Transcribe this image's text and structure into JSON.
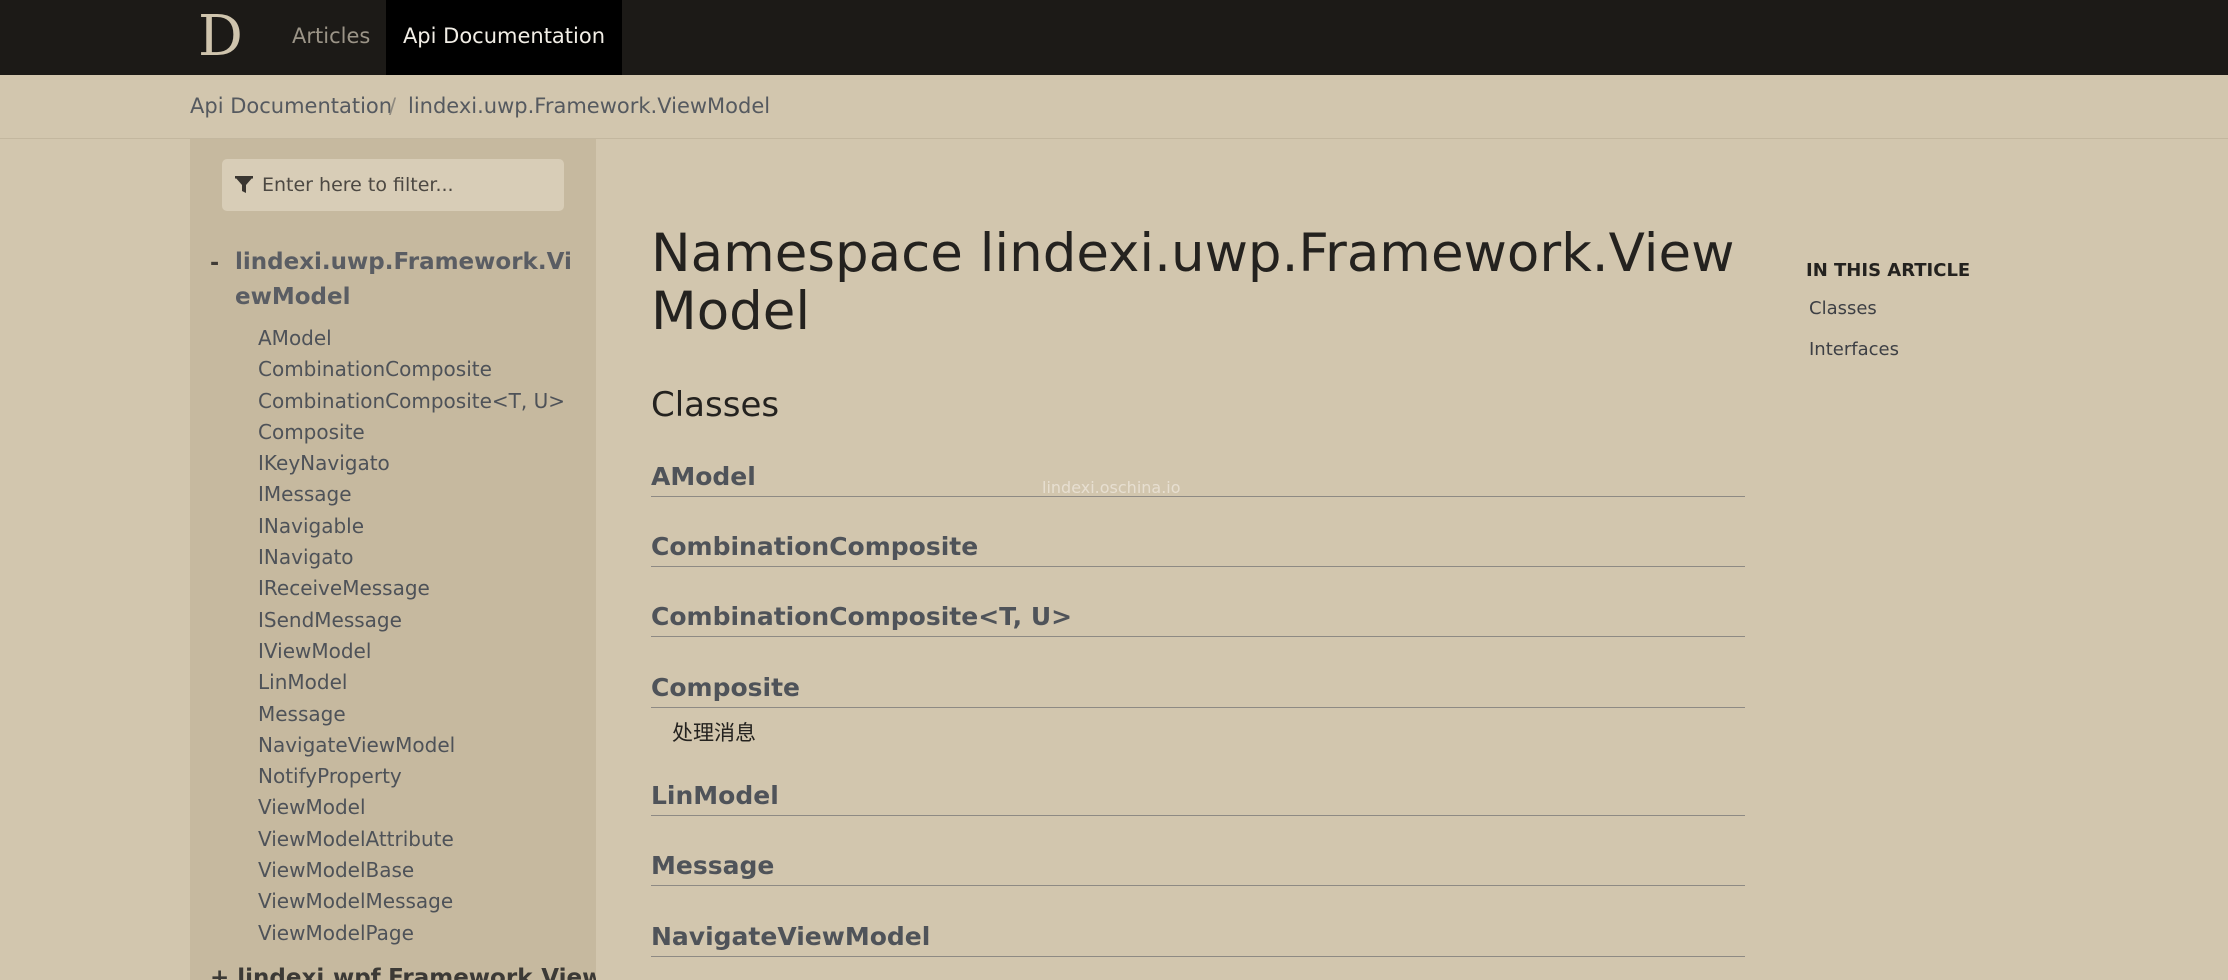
{
  "nav": {
    "logo": "D",
    "articles": "Articles",
    "api_documentation": "Api Documentation"
  },
  "breadcrumb": {
    "root": "Api Documentation",
    "separator": "/",
    "current": "lindexi.uwp.Framework.ViewModel"
  },
  "sidebar": {
    "filter_placeholder": "Enter here to filter...",
    "toggle": "-",
    "namespace": "lindexi.uwp.Framework.ViewModel",
    "items": [
      "AModel",
      "CombinationComposite",
      "CombinationComposite<T, U>",
      "Composite",
      "IKeyNavigato",
      "IMessage",
      "INavigable",
      "INavigato",
      "IReceiveMessage",
      "ISendMessage",
      "IViewModel",
      "LinModel",
      "Message",
      "NavigateViewModel",
      "NotifyProperty",
      "ViewModel",
      "ViewModelAttribute",
      "ViewModelBase",
      "ViewModelMessage",
      "ViewModelPage"
    ],
    "next_namespace": "+ lindexi.wpf.Framework.View"
  },
  "main": {
    "title": "Namespace lindexi.uwp.Framework.ViewModel",
    "section": "Classes",
    "classes": [
      {
        "name": "AModel",
        "desc": ""
      },
      {
        "name": "CombinationComposite",
        "desc": ""
      },
      {
        "name": "CombinationComposite<T, U>",
        "desc": ""
      },
      {
        "name": "Composite",
        "desc": "处理消息"
      },
      {
        "name": "LinModel",
        "desc": ""
      },
      {
        "name": "Message",
        "desc": ""
      },
      {
        "name": "NavigateViewModel",
        "desc": ""
      }
    ],
    "watermark": "lindexi.oschina.io"
  },
  "toc": {
    "heading": "IN THIS ARTICLE",
    "items": [
      "Classes",
      "Interfaces"
    ]
  },
  "colors": {
    "nav_bg": "#1c1a17",
    "page_bg": "#d2c6ae",
    "sidebar_bg": "#c6b99f",
    "link": "#4f5359"
  }
}
